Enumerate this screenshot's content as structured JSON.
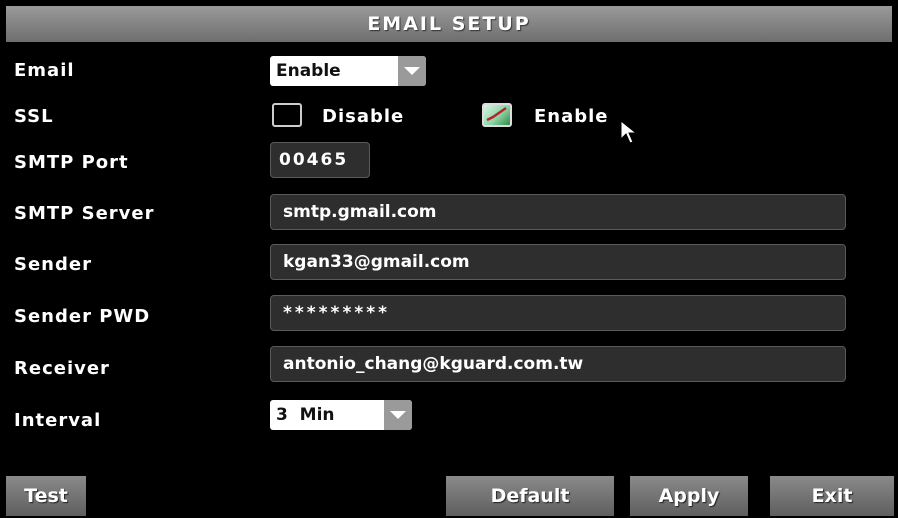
{
  "title": "EMAIL SETUP",
  "rows": {
    "email": {
      "label": "Email",
      "value": "Enable"
    },
    "ssl": {
      "label": "SSL",
      "option_disable": "Disable",
      "option_enable": "Enable",
      "selected": "Enable"
    },
    "smtp_port": {
      "label": "SMTP Port",
      "value": "00465"
    },
    "smtp_server": {
      "label": "SMTP Server",
      "value": "smtp.gmail.com"
    },
    "sender": {
      "label": "Sender",
      "value": "kgan33@gmail.com"
    },
    "sender_pwd": {
      "label": "Sender PWD",
      "value": "*********"
    },
    "receiver": {
      "label": "Receiver",
      "value": "antonio_chang@kguard.com.tw"
    },
    "interval": {
      "label": "Interval",
      "value": "3  Min"
    }
  },
  "buttons": {
    "test": "Test",
    "default": "Default",
    "apply": "Apply",
    "exit": "Exit"
  },
  "icons": {
    "dropdown": "chevron-down-icon",
    "checkmark": "checkmark-icon",
    "cursor": "mouse-pointer-icon"
  }
}
